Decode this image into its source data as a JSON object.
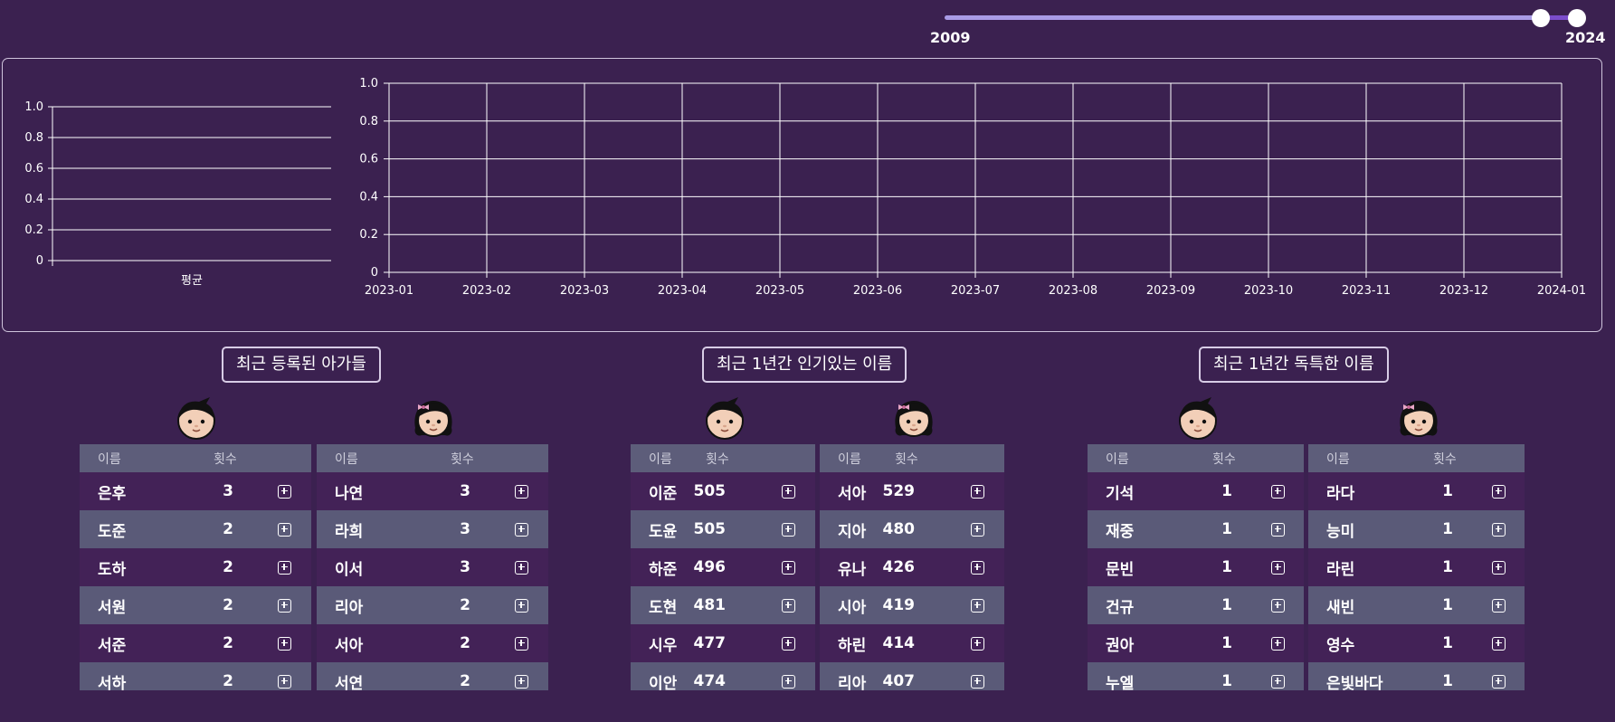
{
  "slider": {
    "min_label": "2009",
    "max_label": "2024",
    "from": 2023,
    "to": 2024
  },
  "colors": {
    "background": "#3b2150",
    "row_dark": "#432257",
    "row_light": "#5a5a78",
    "header": "#5d5d7a",
    "slider_track": "#a99be6",
    "slider_accent": "#7b4dcc"
  },
  "chart_data": [
    {
      "type": "bar",
      "categories": [
        "평균"
      ],
      "values": [],
      "ylim": [
        0,
        1
      ],
      "yticks": [
        "0",
        "0.2",
        "0.4",
        "0.6",
        "0.8",
        "1.0"
      ],
      "grid": true
    },
    {
      "type": "line",
      "x": [
        "2023-01",
        "2023-02",
        "2023-03",
        "2023-04",
        "2023-05",
        "2023-06",
        "2023-07",
        "2023-08",
        "2023-09",
        "2023-10",
        "2023-11",
        "2023-12",
        "2024-01"
      ],
      "series": [],
      "ylim": [
        0,
        1
      ],
      "yticks": [
        "0",
        "0.2",
        "0.4",
        "0.6",
        "0.8",
        "1.0"
      ],
      "grid": true
    }
  ],
  "sections": [
    {
      "title": "최근 등록된 아가들",
      "tables": [
        {
          "gender": "boy",
          "icon": "boy-icon",
          "header": {
            "name": "이름",
            "count": "횟수"
          },
          "rows": [
            {
              "name": "은후",
              "count": "3"
            },
            {
              "name": "도준",
              "count": "2"
            },
            {
              "name": "도하",
              "count": "2"
            },
            {
              "name": "서원",
              "count": "2"
            },
            {
              "name": "서준",
              "count": "2"
            },
            {
              "name": "서하",
              "count": "2"
            }
          ]
        },
        {
          "gender": "girl",
          "icon": "girl-icon",
          "header": {
            "name": "이름",
            "count": "횟수"
          },
          "rows": [
            {
              "name": "나연",
              "count": "3"
            },
            {
              "name": "라희",
              "count": "3"
            },
            {
              "name": "이서",
              "count": "3"
            },
            {
              "name": "리아",
              "count": "2"
            },
            {
              "name": "서아",
              "count": "2"
            },
            {
              "name": "서연",
              "count": "2"
            }
          ]
        }
      ]
    },
    {
      "title": "최근 1년간 인기있는 이름",
      "tables": [
        {
          "gender": "boy",
          "icon": "boy-icon",
          "header": {
            "name": "이름",
            "count": "횟수"
          },
          "rows": [
            {
              "name": "이준",
              "count": "505"
            },
            {
              "name": "도윤",
              "count": "505"
            },
            {
              "name": "하준",
              "count": "496"
            },
            {
              "name": "도현",
              "count": "481"
            },
            {
              "name": "시우",
              "count": "477"
            },
            {
              "name": "이안",
              "count": "474"
            }
          ]
        },
        {
          "gender": "girl",
          "icon": "girl-icon",
          "header": {
            "name": "이름",
            "count": "횟수"
          },
          "rows": [
            {
              "name": "서아",
              "count": "529"
            },
            {
              "name": "지아",
              "count": "480"
            },
            {
              "name": "유나",
              "count": "426"
            },
            {
              "name": "시아",
              "count": "419"
            },
            {
              "name": "하린",
              "count": "414"
            },
            {
              "name": "리아",
              "count": "407"
            }
          ]
        }
      ]
    },
    {
      "title": "최근 1년간 독특한 이름",
      "tables": [
        {
          "gender": "boy",
          "icon": "boy-icon",
          "header": {
            "name": "이름",
            "count": "횟수"
          },
          "rows": [
            {
              "name": "기석",
              "count": "1"
            },
            {
              "name": "재중",
              "count": "1"
            },
            {
              "name": "문빈",
              "count": "1"
            },
            {
              "name": "건규",
              "count": "1"
            },
            {
              "name": "권아",
              "count": "1"
            },
            {
              "name": "누엘",
              "count": "1"
            }
          ]
        },
        {
          "gender": "girl",
          "icon": "girl-icon",
          "header": {
            "name": "이름",
            "count": "횟수"
          },
          "rows": [
            {
              "name": "라다",
              "count": "1"
            },
            {
              "name": "능미",
              "count": "1"
            },
            {
              "name": "라린",
              "count": "1"
            },
            {
              "name": "새빈",
              "count": "1"
            },
            {
              "name": "영수",
              "count": "1"
            },
            {
              "name": "은빛바다",
              "count": "1"
            }
          ]
        }
      ]
    }
  ]
}
